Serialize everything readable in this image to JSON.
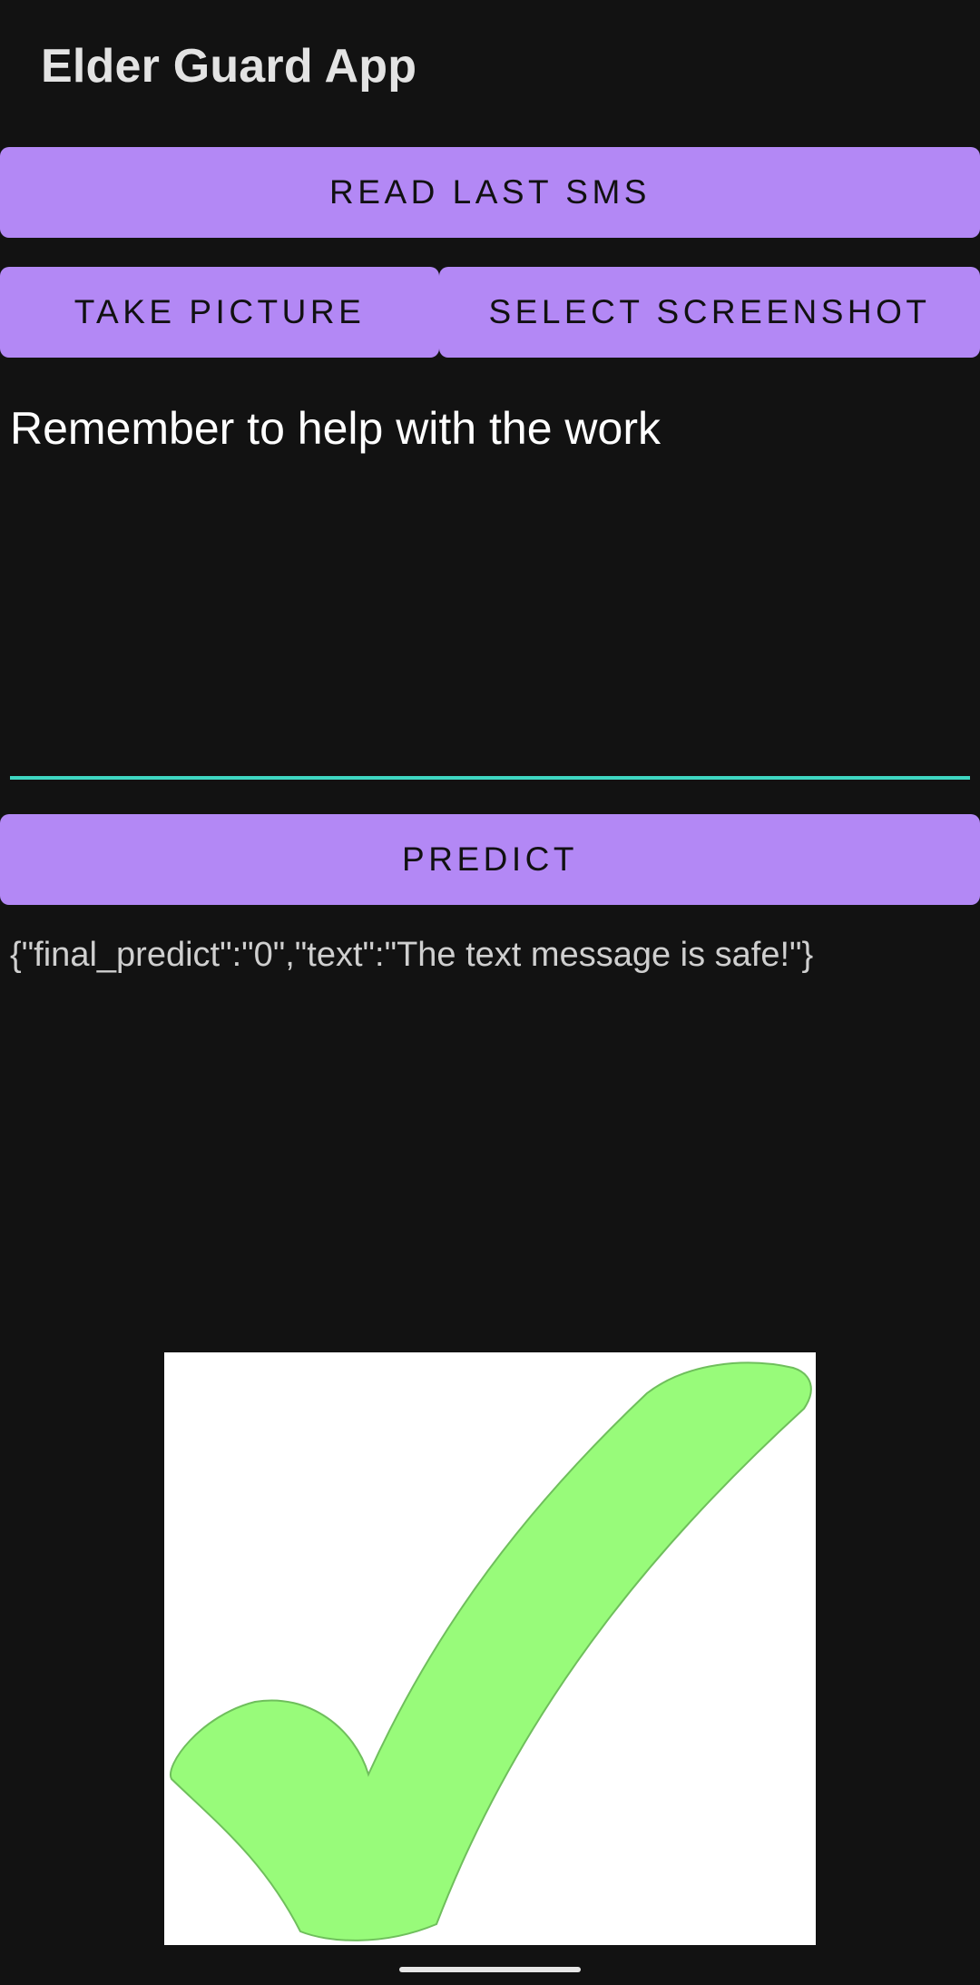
{
  "app": {
    "title": "Elder Guard App"
  },
  "buttons": {
    "read_sms": "READ LAST SMS",
    "take_picture": "TAKE PICTURE",
    "select_screenshot": "SELECT SCREENSHOT",
    "predict": "PREDICT"
  },
  "message_input": {
    "value": "Remember to help with the work"
  },
  "result": {
    "text": "{\"final_predict\":\"0\",\"text\":\"The text message is safe!\"}"
  },
  "result_image": {
    "icon": "checkmark-icon",
    "fill_color": "#98fb7a",
    "background_color": "#ffffff"
  },
  "colors": {
    "background": "#121212",
    "button": "#b388f5",
    "input_underline": "#3ed7c2"
  }
}
